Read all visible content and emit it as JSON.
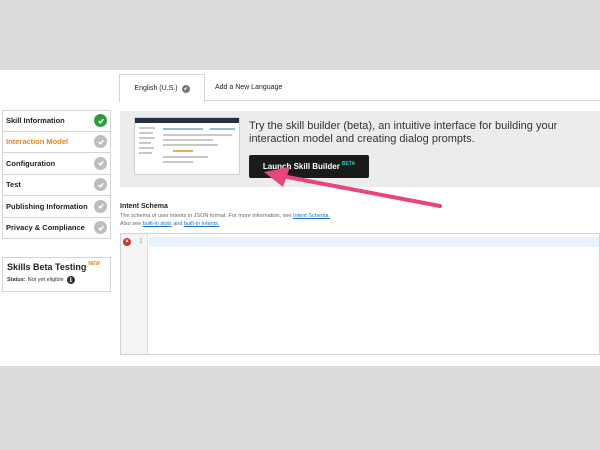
{
  "tabs": [
    {
      "label": "English (U.S.)",
      "selected": true
    },
    {
      "label": "Add a New Language",
      "selected": false
    }
  ],
  "sidebar": {
    "steps": [
      {
        "label": "Skill Information",
        "status": "complete"
      },
      {
        "label": "Interaction Model",
        "status": "active"
      },
      {
        "label": "Configuration",
        "status": "incomplete"
      },
      {
        "label": "Test",
        "status": "incomplete"
      },
      {
        "label": "Publishing Information",
        "status": "incomplete"
      },
      {
        "label": "Privacy & Compliance",
        "status": "incomplete"
      }
    ],
    "beta": {
      "title": "Skills Beta Testing",
      "badge": "NEW",
      "status_label": "Status:",
      "status_value": "Not yet eligible"
    }
  },
  "banner": {
    "text": "Try the skill builder (beta), an intuitive interface for building your interaction model and creating dialog prompts.",
    "button_label": "Launch Skill Builder",
    "button_badge": "BETA"
  },
  "schema": {
    "title": "Intent Schema",
    "desc_line1": "The schema of user intents in JSON format. For more information, see",
    "desc_link1": "Intent Schema.",
    "desc_line2_pre": "Also see",
    "desc_link2": "built-in slots",
    "desc_and": "and",
    "desc_link3": "built-in intents.",
    "line_number": "1"
  },
  "colors": {
    "active_step": "#e2861a",
    "complete": "#2f9e3a",
    "arrow": "#e8457a",
    "link": "#1a73c8",
    "button_bg": "#1b1b1b"
  }
}
